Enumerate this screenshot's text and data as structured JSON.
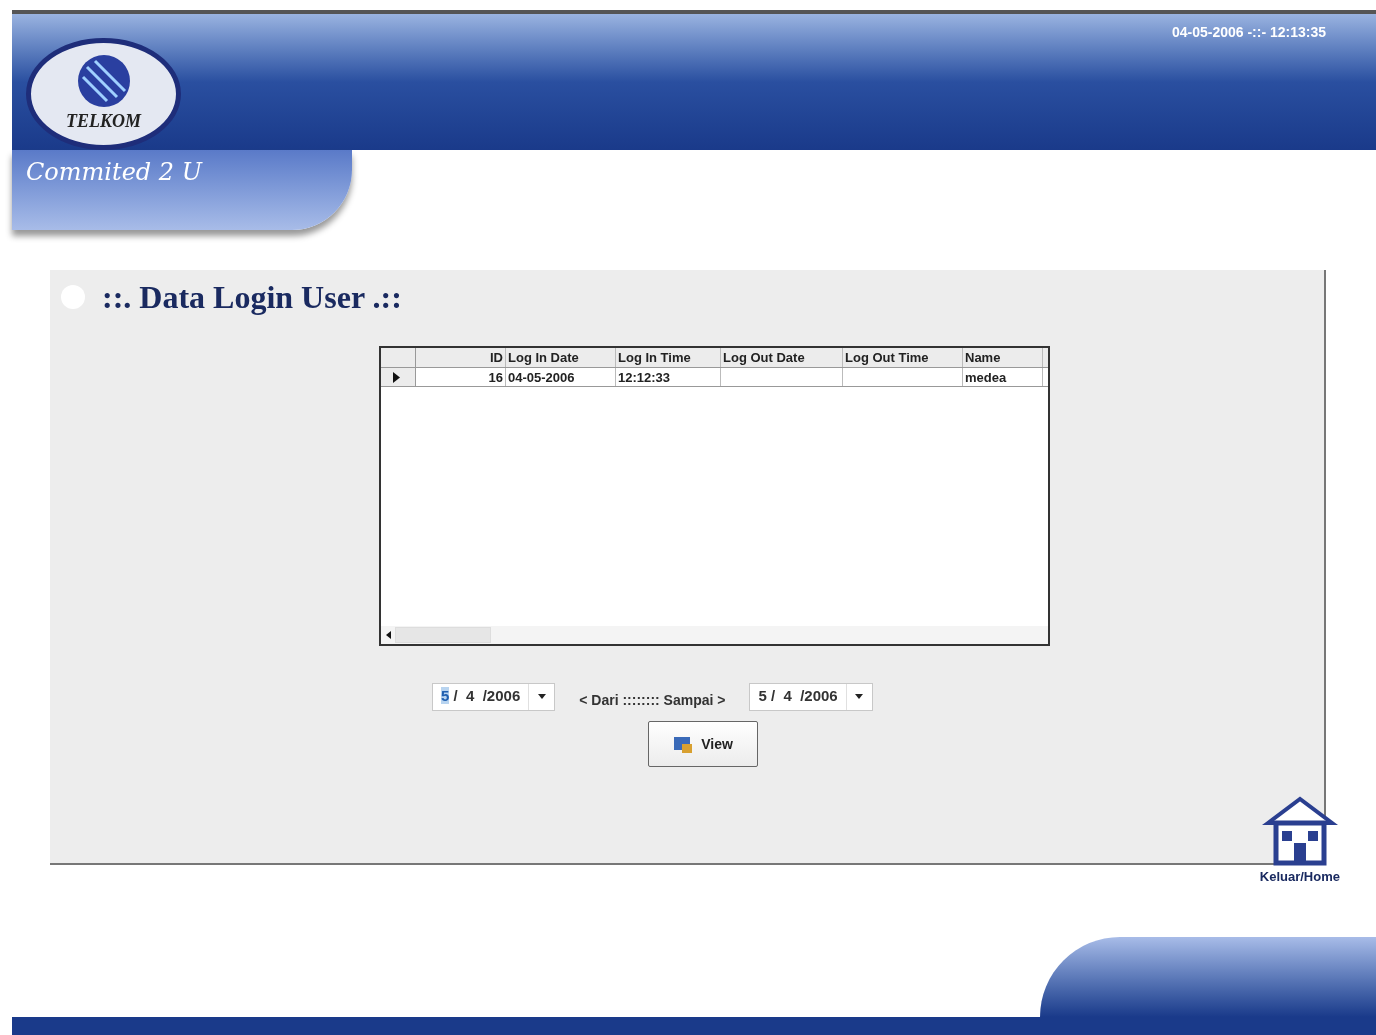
{
  "header": {
    "logo_text": "TELKOM",
    "slogan": "Commited 2 U",
    "datetime": "04-05-2006 -::- 12:13:35"
  },
  "panel": {
    "title": "::. Data Login User .::",
    "grid": {
      "columns": [
        "ID",
        "Log In Date",
        "Log In Time",
        "Log Out Date",
        "Log Out Time",
        "Name"
      ],
      "rows": [
        {
          "selected": true,
          "cells": [
            "16",
            "04-05-2006",
            "12:12:33",
            "",
            "",
            "medea"
          ]
        }
      ]
    },
    "date_from": {
      "day": "5",
      "rest": " /  4  /2006",
      "day_selected": true
    },
    "range_label": "< Dari :::::::: Sampai >",
    "date_to": {
      "day": "5",
      "rest": " /  4  /2006",
      "day_selected": false
    },
    "view_button": "View"
  },
  "home_link": "Keluar/Home"
}
